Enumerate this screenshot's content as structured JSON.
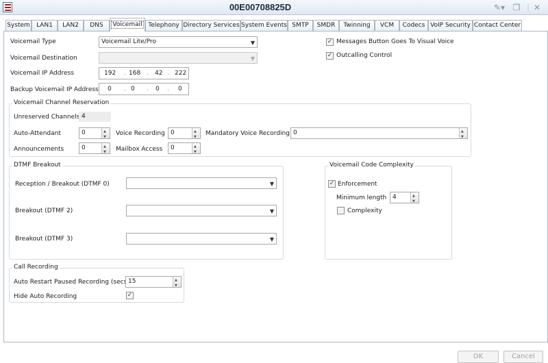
{
  "window": {
    "title": "00E00708825D"
  },
  "tabs": [
    "System",
    "LAN1",
    "LAN2",
    "DNS",
    "Voicemail",
    "Telephony",
    "Directory Services",
    "System Events",
    "SMTP",
    "SMDR",
    "Twinning",
    "VCM",
    "Codecs",
    "VoIP Security",
    "Contact Center"
  ],
  "active_tab": "Voicemail",
  "voicemail": {
    "type_label": "Voicemail Type",
    "type_value": "Voicemail Lite/Pro",
    "dest_label": "Voicemail Destination",
    "dest_value": "",
    "ip_label": "Voicemail IP Address",
    "ip": [
      "192",
      "168",
      "42",
      "222"
    ],
    "backup_ip_label": "Backup Voicemail IP Address",
    "backup_ip": [
      "0",
      "0",
      "0",
      "0"
    ],
    "msg_button_label": "Messages Button Goes To Visual Voice",
    "msg_button_checked": true,
    "outcalling_label": "Outcalling Control",
    "outcalling_checked": true
  },
  "channel_reservation": {
    "title": "Voicemail Channel Reservation",
    "unreserved_label": "Unreserved Channels",
    "unreserved_value": "4",
    "auto_attendant_label": "Auto-Attendant",
    "auto_attendant_value": "0",
    "voice_recording_label": "Voice Recording",
    "voice_recording_value": "0",
    "mandatory_label": "Mandatory Voice Recording",
    "mandatory_value": "0",
    "announcements_label": "Announcements",
    "announcements_value": "0",
    "mailbox_label": "Mailbox Access",
    "mailbox_value": "0"
  },
  "dtmf": {
    "title": "DTMF Breakout",
    "reception_label": "Reception / Breakout (DTMF 0)",
    "reception_value": "",
    "breakout2_label": "Breakout (DTMF 2)",
    "breakout2_value": "",
    "breakout3_label": "Breakout (DTMF 3)",
    "breakout3_value": ""
  },
  "code_complexity": {
    "title": "Voicemail Code Complexity",
    "enforcement_label": "Enforcement",
    "enforcement_checked": true,
    "min_length_label": "Minimum length",
    "min_length_value": "4",
    "complexity_label": "Complexity",
    "complexity_checked": false
  },
  "call_recording": {
    "title": "Call Recording",
    "auto_restart_label": "Auto Restart Paused Recording (secs)",
    "auto_restart_value": "15",
    "hide_auto_label": "Hide Auto Recording",
    "hide_auto_checked": true
  },
  "buttons": {
    "ok": "OK",
    "cancel": "Cancel"
  }
}
